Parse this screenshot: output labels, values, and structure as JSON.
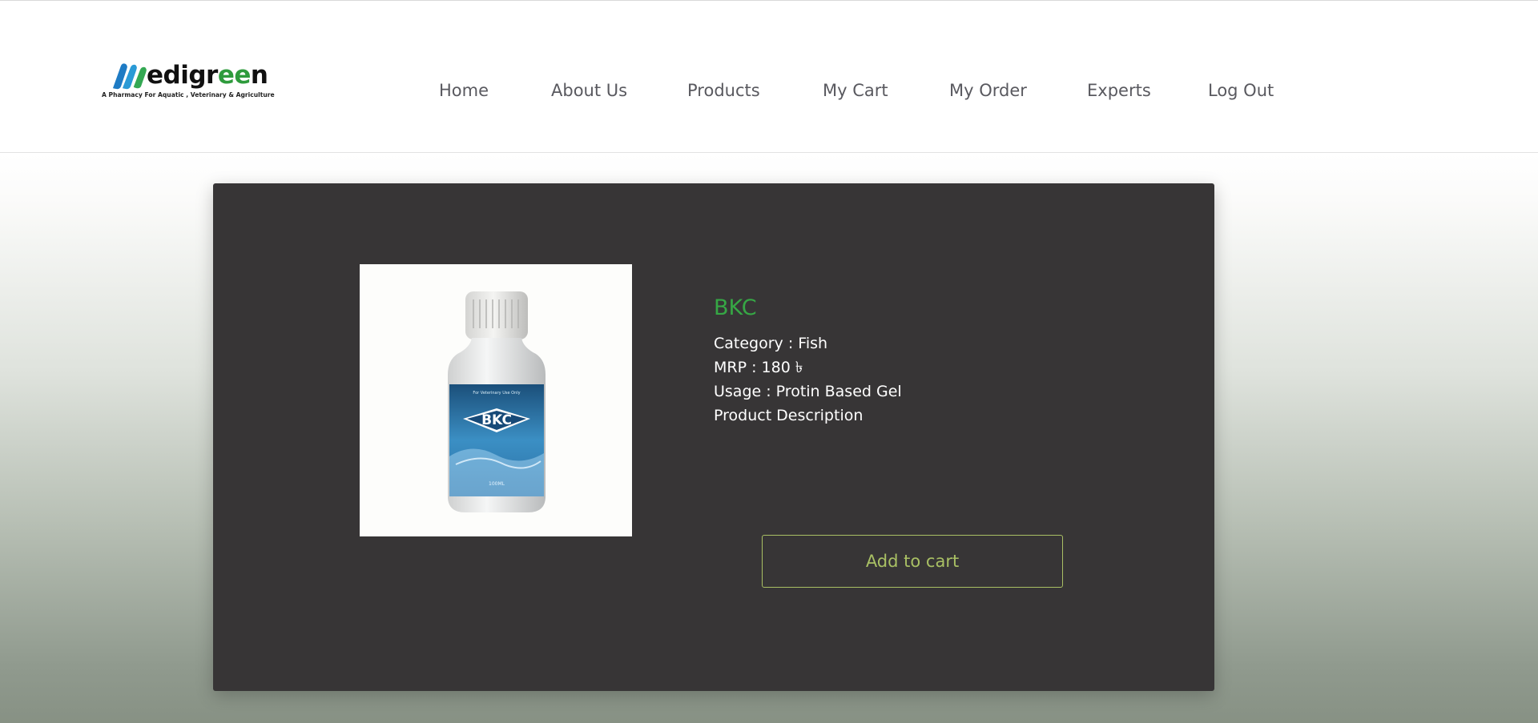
{
  "brand": {
    "name_prefix": "M",
    "name_main": "edigr",
    "name_ee": "ee",
    "name_end": "n",
    "tagline": "A Pharmacy For Aquatic , Veterinary & Agriculture",
    "colors": {
      "blue": "#1e7bc4",
      "green": "#2e9b3c",
      "text": "#111111"
    }
  },
  "nav": {
    "items": [
      {
        "label": "Home"
      },
      {
        "label": "About Us"
      },
      {
        "label": "Products"
      },
      {
        "label": "My Cart"
      },
      {
        "label": "My Order"
      },
      {
        "label": "Experts"
      },
      {
        "label": "Log Out"
      }
    ]
  },
  "product": {
    "name": "BKC",
    "category": "Category : Fish",
    "mrp": "MRP : 180 ৳",
    "usage": "Usage : Protin Based Gel",
    "description": "Product Description",
    "image_label": "BKC",
    "image_small_text": "For Veterinary Use Only",
    "image_volume": "100ML",
    "add_to_cart_label": "Add to cart"
  },
  "colors": {
    "accent_green": "#36a745",
    "button_olive": "#a9c064",
    "card_bg": "#373536",
    "nav_text": "#59595f"
  }
}
